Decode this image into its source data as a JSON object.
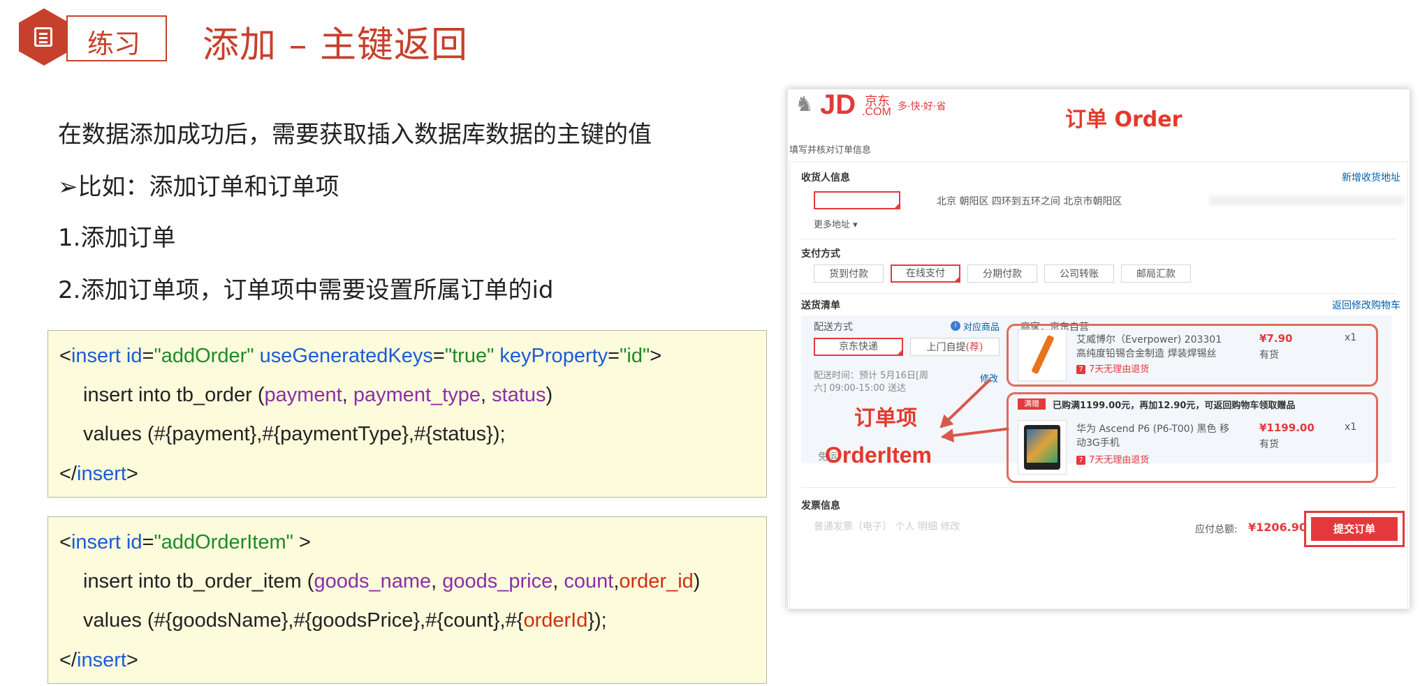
{
  "header": {
    "section_tag": "练习",
    "title": "添加 – 主键返回",
    "icon": "document-icon"
  },
  "bullets": [
    "在数据添加成功后，需要获取插入数据库数据的主键的值",
    "➢比如：添加订单和订单项",
    "1.添加订单",
    "2.添加订单项，订单项中需要设置所属订单的id"
  ],
  "code1": {
    "l1": {
      "a": "<",
      "b": "insert",
      "c": " id",
      "d": "=",
      "e": "\"addOrder\"",
      "f": " useGeneratedKeys",
      "g": "=",
      "h": "\"true\"",
      "i": " keyProperty",
      "j": "=",
      "k": "\"id\"",
      "l": ">"
    },
    "l2": {
      "a": "insert into tb_order (",
      "b": "payment",
      "c": ", ",
      "d": "payment_type",
      "e": ", ",
      "f": "status",
      "g": ")"
    },
    "l3": {
      "a": "values (#{payment},#{paymentType},#{status});"
    },
    "l4": {
      "a": "</",
      "b": "insert",
      "c": ">"
    }
  },
  "code2": {
    "l1": {
      "a": "<",
      "b": "insert",
      "c": " id",
      "d": "=",
      "e": "\"addOrderItem\"",
      "f": " >"
    },
    "l2": {
      "a": "insert into tb_order_item (",
      "b": "goods_name",
      "c": ", ",
      "d": "goods_price",
      "e": ", ",
      "f": "count",
      "g": ",",
      "h": "order_id",
      "i": ")"
    },
    "l3": {
      "a": "values (#{goodsName},#{goodsPrice},#{count},#{",
      "b": "orderId",
      "c": "});"
    },
    "l4": {
      "a": "</",
      "b": "insert",
      "c": ">"
    }
  },
  "shot": {
    "logo_jd": "JD",
    "logo_dot": ".COM",
    "logo_cn": "京东",
    "slogan": "多·快·好·省",
    "annotation_order": "订单 Order",
    "page_heading": "填写并核对订单信息",
    "receiver_title": "收货人信息",
    "new_address": "新增收货地址",
    "address": "北京 朝阳区 四环到五环之间 北京市朝阳区",
    "more_address": "更多地址 ▾",
    "pay_title": "支付方式",
    "pay_options": [
      "货到付款",
      "在线支付",
      "分期付款",
      "公司转账",
      "邮局汇款"
    ],
    "list_title": "送货清单",
    "back_cart": "返回修改购物车",
    "ship_title": "配送方式",
    "goods_link": "对应商品",
    "seller": "商家：京东自营",
    "ship_options": [
      "京东快递",
      "上门自提",
      "(荐)"
    ],
    "ship_time": "配送时间：预计 5月16日[周六] 09:00-15:00 送达",
    "ship_modify": "修改",
    "item1_name": "艾威博尔（Everpower) 203301",
    "item1_desc": "高纯度铅锡合金制造 焊装焊锡丝",
    "item1_price": "¥7.90",
    "item1_qty": "x1",
    "item1_stock": "有货",
    "return_policy": "7天无理由退货",
    "promo_tag": "满赠",
    "promo_text": "已购满1199.00元，再加12.90元，可返回购物车领取赠品",
    "item2_name": "华为 Ascend P6 (P6-T00) 黑色 移",
    "item2_desc": "动3G手机",
    "item2_price": "¥1199.00",
    "item2_qty": "x1",
    "item2_stock": "有货",
    "annotation_item_cn": "订单项",
    "annotation_item_en": "OrderItem",
    "freight_cut": "免运",
    "invoice_title": "发票信息",
    "invoice_faded": "普通发票（电子）  个人  明细  修改",
    "total_label": "应付总额:",
    "total_value": "¥1206.90",
    "submit": "提交订单"
  },
  "colors": {
    "accent": "#c7402c",
    "jd_red": "#e4393c",
    "code_bg": "#fcfbdc",
    "keyword": "#1c5bd6",
    "string": "#208a26",
    "column": "#8b2fa8"
  }
}
